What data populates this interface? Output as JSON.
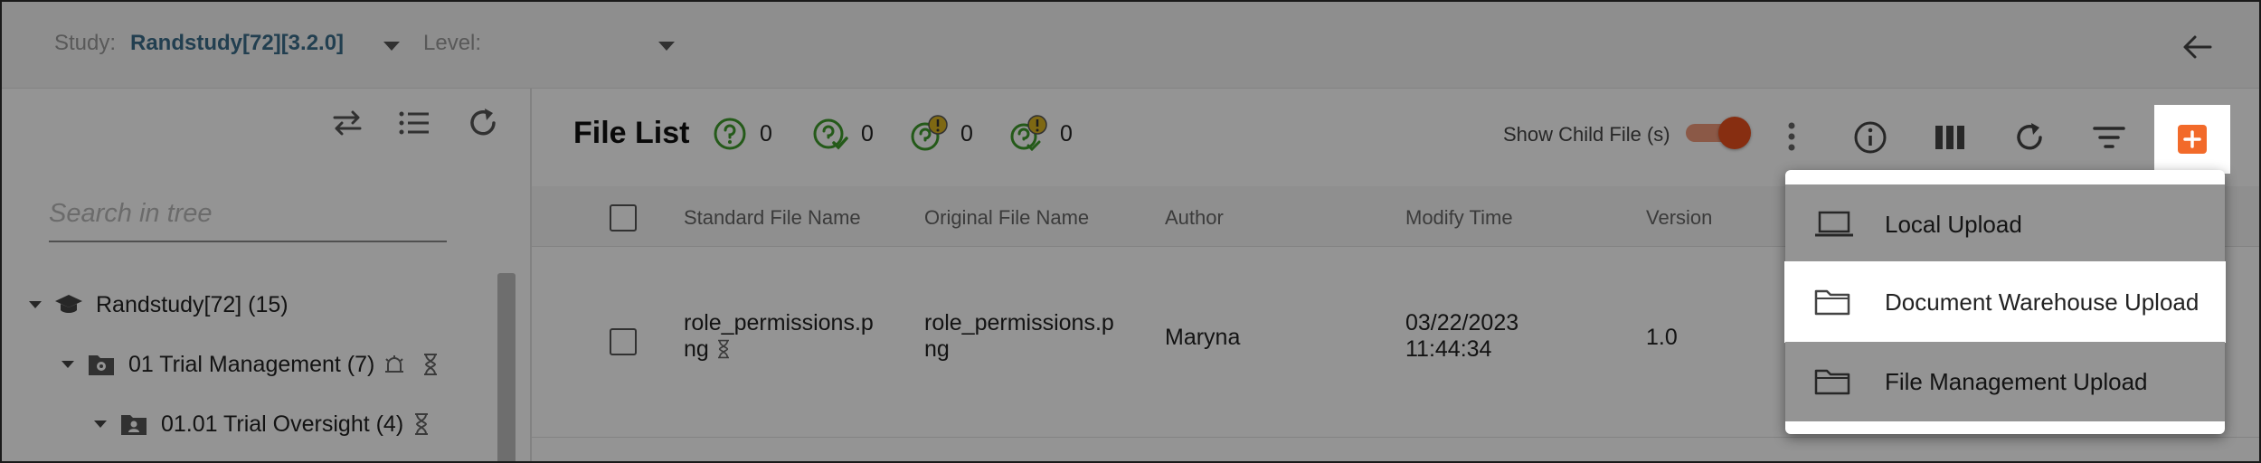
{
  "topbar": {
    "study_label": "Study:",
    "study_value": "Randstudy[72][3.2.0]",
    "level_label": "Level:",
    "level_value": ""
  },
  "tree": {
    "search_placeholder": "Search in tree",
    "nodes": [
      {
        "label": "Randstudy[72] (15)",
        "icon": "graduation-cap-icon"
      },
      {
        "label": "01  Trial Management (7)",
        "icon": "folder-gear-icon"
      },
      {
        "label": "01.01  Trial Oversight (4)",
        "icon": "folder-users-icon"
      }
    ]
  },
  "file_list": {
    "title": "File List",
    "stats": [
      {
        "icon": "question-circle-icon",
        "count": "0"
      },
      {
        "icon": "question-check-icon",
        "count": "0"
      },
      {
        "icon": "question-alert-icon",
        "count": "0"
      },
      {
        "icon": "question-check-alert-icon",
        "count": "0"
      }
    ],
    "show_child_label": "Show Child File (s)",
    "show_child_on": true,
    "columns": [
      "Standard File Name",
      "Original File Name",
      "Author",
      "Modify Time",
      "Version"
    ],
    "rows": [
      {
        "standard_name_l1": "role_permissions.p",
        "standard_name_l2": "ng ",
        "original_name_l1": "role_permissions.p",
        "original_name_l2": "ng",
        "author": "Maryna",
        "modify_date": "03/22/2023",
        "modify_time": "11:44:34",
        "version": "1.0"
      }
    ]
  },
  "upload_menu": {
    "items": [
      {
        "label": "Local Upload",
        "icon": "laptop-icon",
        "highlighted": false
      },
      {
        "label": "Document Warehouse Upload",
        "icon": "folder-icon",
        "highlighted": true
      },
      {
        "label": "File Management Upload",
        "icon": "folder-icon",
        "highlighted": false
      }
    ]
  },
  "colors": {
    "accent": "#f26a2a",
    "stat_green": "#3e9b2b",
    "alert_yellow": "#d9b321",
    "study_blue": "#3c6d8a",
    "link_blue": "#1f5fa8"
  }
}
